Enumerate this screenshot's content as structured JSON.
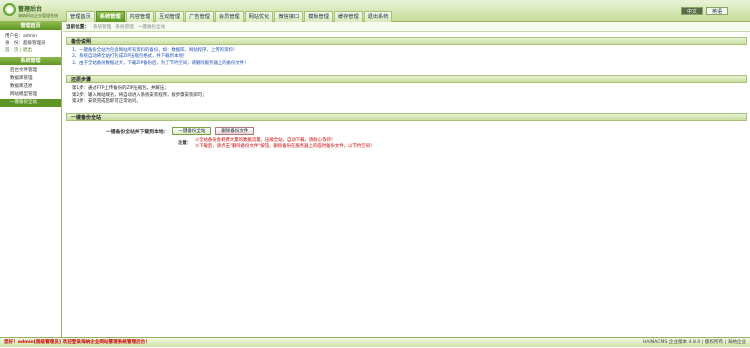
{
  "brand": {
    "title": "管理后台",
    "subtitle": "海纳网站企业管理系统"
  },
  "nav": {
    "tabs": [
      {
        "label": "管理首页",
        "active": false
      },
      {
        "label": "系统管理",
        "active": true
      },
      {
        "label": "内容管理",
        "active": false
      },
      {
        "label": "互动管理",
        "active": false
      },
      {
        "label": "广告管理",
        "active": false
      },
      {
        "label": "会员管理",
        "active": false
      },
      {
        "label": "网站优化",
        "active": false
      },
      {
        "label": "微信接口",
        "active": false
      },
      {
        "label": "模板管理",
        "active": false
      },
      {
        "label": "缓存管理",
        "active": false
      },
      {
        "label": "退出系统",
        "active": false
      }
    ],
    "top_right": [
      "中文",
      "英语"
    ]
  },
  "sidebar": {
    "header1": "管理首页",
    "user_label": "用户名：admin",
    "role_label": "身　份：超级管理员",
    "links_label": "首　页 | 退出",
    "header2": "系统管理",
    "items": [
      {
        "label": "后台文件管理",
        "active": false
      },
      {
        "label": "数据库管理",
        "active": false
      },
      {
        "label": "数据库还原",
        "active": false
      },
      {
        "label": "网站模型管理",
        "active": false
      },
      {
        "label": "一键备份全站",
        "active": true
      }
    ]
  },
  "breadcrumb": {
    "label": "当前位置：",
    "items": [
      "系统管理",
      "系统管理",
      "一键备份全站"
    ]
  },
  "sections": {
    "desc": {
      "title": "备份说明",
      "lines": [
        "1、一键备份全站为包含网站所有资料的备份，如：数据库、网站程序、上传的资料！",
        "2、系统自动将全站打包成ZIP压缩包格式，并下载到本地！",
        "3、由于全站备份数据过大，下载ZIP备份后，为了节约空间，请删除服务器上的备份文件！"
      ]
    },
    "restore": {
      "title": "还原步骤",
      "lines": [
        "第1步：通过FTP上传备份的ZIP压缩包，并解压；",
        "第2步：输入网站域名，将自动进入系统安装程序，按步骤安装即可；",
        "第3步：安装完成后即可正常访问。"
      ]
    },
    "backup": {
      "title": "一键备份全站",
      "label": "一键备份全站并下载到本地：",
      "btn1": "一键备份全站",
      "btn2": "删除备份文件",
      "note_label": "注意：",
      "note_lines": [
        "①全站备份会耗费大量的数据流量，压缩全站，自动下载，请耐心等待！",
        "②下载后，请点击\"删除备份文件\"按钮，删除备份在服务器上的临时备份文件，以节约空间！"
      ]
    }
  },
  "status": {
    "left": "您好！admin[超级管理员] 欢迎登录海纳企业网站管理系统管理后台！",
    "right": "HAINACMS 企业版本 4.8.0 | 版权所有 | 海纳企业"
  }
}
